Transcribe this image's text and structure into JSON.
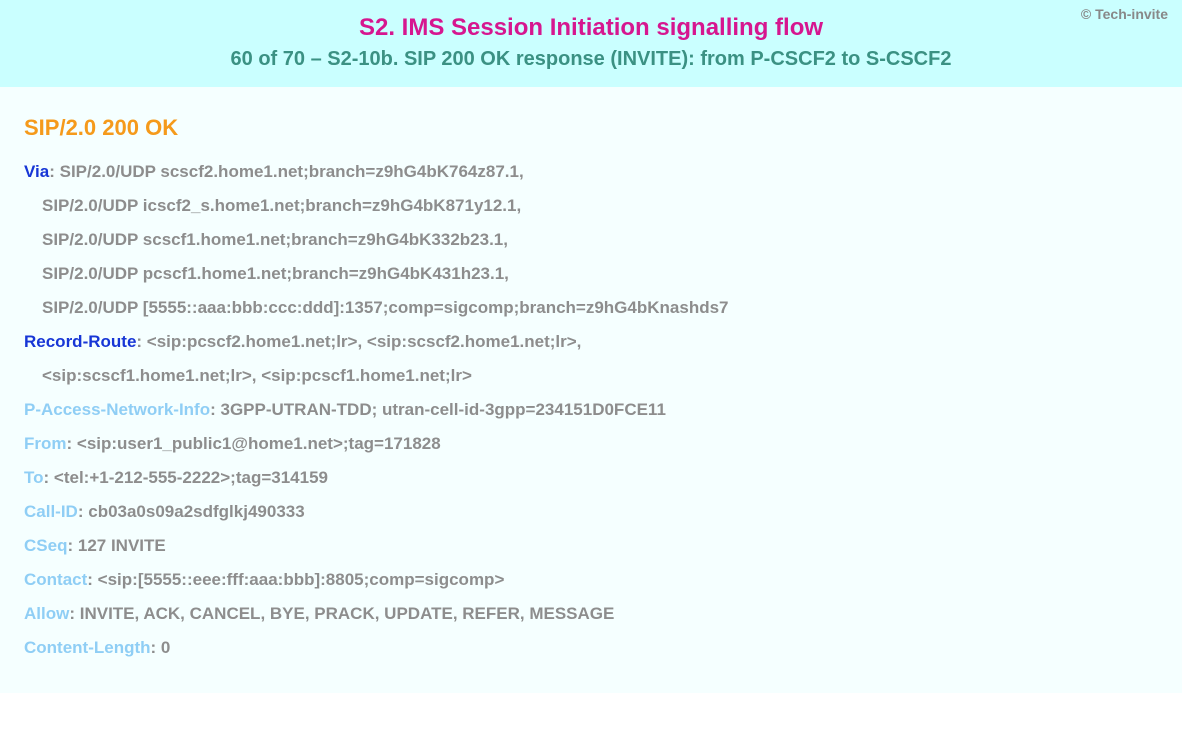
{
  "copyright": "© Tech-invite",
  "title": "S2. IMS Session Initiation signalling flow",
  "subtitle": "60 of 70 – S2-10b. SIP 200 OK response (INVITE): from P-CSCF2 to S-CSCF2",
  "status_line": "SIP/2.0 200 OK",
  "headers": {
    "via": {
      "name": "Via",
      "lines": [
        "SIP/2.0/UDP scscf2.home1.net;branch=z9hG4bK764z87.1,",
        "SIP/2.0/UDP icscf2_s.home1.net;branch=z9hG4bK871y12.1,",
        "SIP/2.0/UDP scscf1.home1.net;branch=z9hG4bK332b23.1,",
        "SIP/2.0/UDP pcscf1.home1.net;branch=z9hG4bK431h23.1,",
        "SIP/2.0/UDP [5555::aaa:bbb:ccc:ddd]:1357;comp=sigcomp;branch=z9hG4bKnashds7"
      ]
    },
    "record_route": {
      "name": "Record-Route",
      "lines": [
        "<sip:pcscf2.home1.net;lr>, <sip:scscf2.home1.net;lr>,",
        "<sip:scscf1.home1.net;lr>, <sip:pcscf1.home1.net;lr>"
      ]
    },
    "pani": {
      "name": "P-Access-Network-Info",
      "value": "3GPP-UTRAN-TDD; utran-cell-id-3gpp=234151D0FCE11"
    },
    "from": {
      "name": "From",
      "value": "<sip:user1_public1@home1.net>;tag=171828"
    },
    "to": {
      "name": "To",
      "value": "<tel:+1-212-555-2222>;tag=314159"
    },
    "call_id": {
      "name": "Call-ID",
      "value": "cb03a0s09a2sdfglkj490333"
    },
    "cseq": {
      "name": "CSeq",
      "value": "127 INVITE"
    },
    "contact": {
      "name": "Contact",
      "value": "<sip:[5555::eee:fff:aaa:bbb]:8805;comp=sigcomp>"
    },
    "allow": {
      "name": "Allow",
      "value": "INVITE, ACK, CANCEL, BYE, PRACK, UPDATE, REFER, MESSAGE"
    },
    "content_length": {
      "name": "Content-Length",
      "value": "0"
    }
  }
}
